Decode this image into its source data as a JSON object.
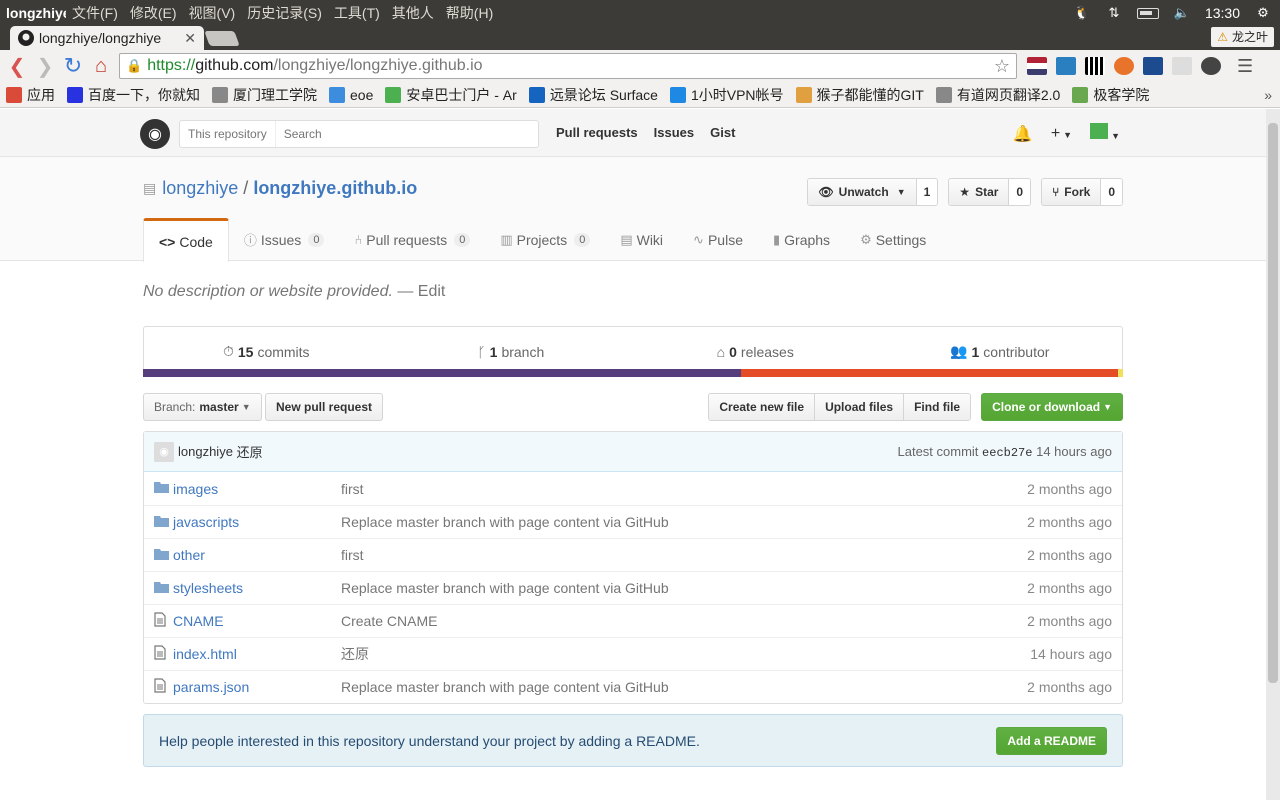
{
  "os": {
    "app_title": "longzhiye",
    "menus": [
      "文件(F)",
      "修改(E)",
      "视图(V)",
      "历史记录(S)",
      "工具(T)",
      "其他人",
      "帮助(H)"
    ],
    "clock": "13:30"
  },
  "browser": {
    "tab_title": "longzhiye/longzhiye",
    "profile_name": "龙之叶",
    "url_scheme": "https://",
    "url_host": "github.com",
    "url_path": "/longzhiye/longzhiye.github.io",
    "bookmarks": [
      {
        "label": "应用",
        "color": "#d94a38"
      },
      {
        "label": "百度一下，你就知",
        "color": "#2932e1"
      },
      {
        "label": "厦门理工学院",
        "color": "#888888"
      },
      {
        "label": "eoe",
        "color": "#3c8dde"
      },
      {
        "label": "安卓巴士门户 - Ar",
        "color": "#4caf50"
      },
      {
        "label": "远景论坛 Surface",
        "color": "#1565c0"
      },
      {
        "label": "1小时VPN帐号",
        "color": "#1e88e5"
      },
      {
        "label": "猴子都能懂的GIT",
        "color": "#e0a040"
      },
      {
        "label": "有道网页翻译2.0",
        "color": "#888888"
      },
      {
        "label": "极客学院",
        "color": "#6aa84f"
      }
    ]
  },
  "github": {
    "search_scope": "This repository",
    "search_placeholder": "Search",
    "nav": [
      "Pull requests",
      "Issues",
      "Gist"
    ],
    "repo_owner": "longzhiye",
    "repo_sep": "/",
    "repo_name": "longzhiye.github.io",
    "actions": {
      "watch_label": "Unwatch",
      "watch_count": "1",
      "star_label": "Star",
      "star_count": "0",
      "fork_label": "Fork",
      "fork_count": "0"
    },
    "tabs": {
      "code": "Code",
      "issues": "Issues",
      "issues_count": "0",
      "pulls": "Pull requests",
      "pulls_count": "0",
      "projects": "Projects",
      "projects_count": "0",
      "wiki": "Wiki",
      "pulse": "Pulse",
      "graphs": "Graphs",
      "settings": "Settings"
    },
    "description": "No description or website provided.",
    "description_edit": "— Edit",
    "summary": {
      "commits_num": "15",
      "commits_label": "commits",
      "branch_num": "1",
      "branch_label": "branch",
      "releases_num": "0",
      "releases_label": "releases",
      "contributors_num": "1",
      "contributors_label": "contributor"
    },
    "languages": [
      {
        "color": "#563d7c",
        "share": 61
      },
      {
        "color": "#e34c26",
        "share": 38.5
      },
      {
        "color": "#f1e05a",
        "share": 0.5
      }
    ],
    "branch_prefix": "Branch:",
    "branch_name": "master",
    "new_pr": "New pull request",
    "create_file": "Create new file",
    "upload_files": "Upload files",
    "find_file": "Find file",
    "clone": "Clone or download",
    "latest_commit": {
      "author": "longzhiye",
      "message": "还原",
      "label": "Latest commit",
      "sha": "eecb27e",
      "age": "14 hours ago"
    },
    "files": [
      {
        "type": "dir",
        "name": "images",
        "message": "first",
        "age": "2 months ago"
      },
      {
        "type": "dir",
        "name": "javascripts",
        "message": "Replace master branch with page content via GitHub",
        "age": "2 months ago"
      },
      {
        "type": "dir",
        "name": "other",
        "message": "first",
        "age": "2 months ago"
      },
      {
        "type": "dir",
        "name": "stylesheets",
        "message": "Replace master branch with page content via GitHub",
        "age": "2 months ago"
      },
      {
        "type": "file",
        "name": "CNAME",
        "message": "Create CNAME",
        "age": "2 months ago"
      },
      {
        "type": "file",
        "name": "index.html",
        "message": "还原",
        "age": "14 hours ago"
      },
      {
        "type": "file",
        "name": "params.json",
        "message": "Replace master branch with page content via GitHub",
        "age": "2 months ago"
      }
    ],
    "readme_prompt": "Help people interested in this repository understand your project by adding a README.",
    "add_readme": "Add a README"
  }
}
